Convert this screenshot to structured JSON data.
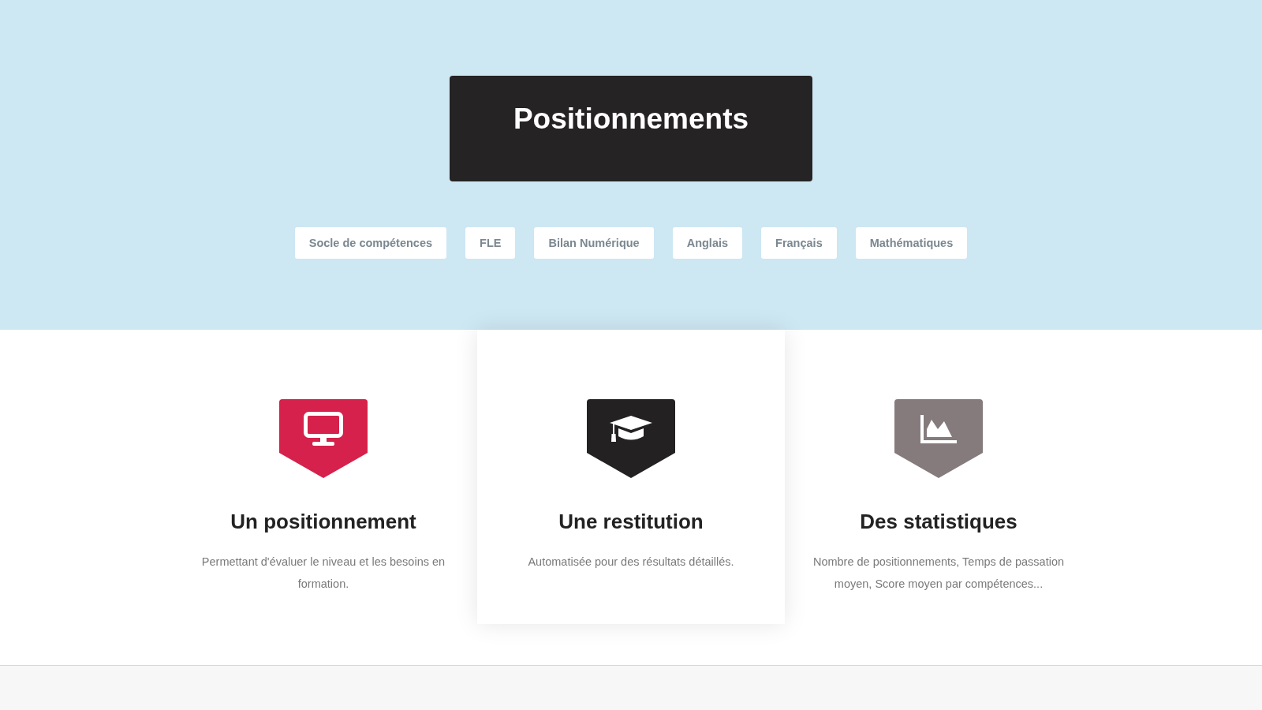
{
  "header": {
    "title": "Positionnements",
    "buttons": [
      {
        "label": "Socle de compétences"
      },
      {
        "label": "FLE"
      },
      {
        "label": "Bilan Numérique"
      },
      {
        "label": "Anglais"
      },
      {
        "label": "Français"
      },
      {
        "label": "Mathématiques"
      }
    ]
  },
  "features": [
    {
      "kind": "monitor",
      "color": "#d5214b",
      "title": "Un positionnement",
      "description": "Permettant d'évaluer le niveau et les besoins en formation.",
      "highlighted": false
    },
    {
      "kind": "graduation-cap",
      "color": "#232122",
      "title": "Une restitution",
      "description": "Automatisée pour des résultats détaillés.",
      "highlighted": true
    },
    {
      "kind": "area-chart",
      "color": "#857b7d",
      "title": "Des statistiques",
      "description": "Nombre de positionnements, Temps de passation moyen, Score moyen par compétences...",
      "highlighted": false
    }
  ]
}
